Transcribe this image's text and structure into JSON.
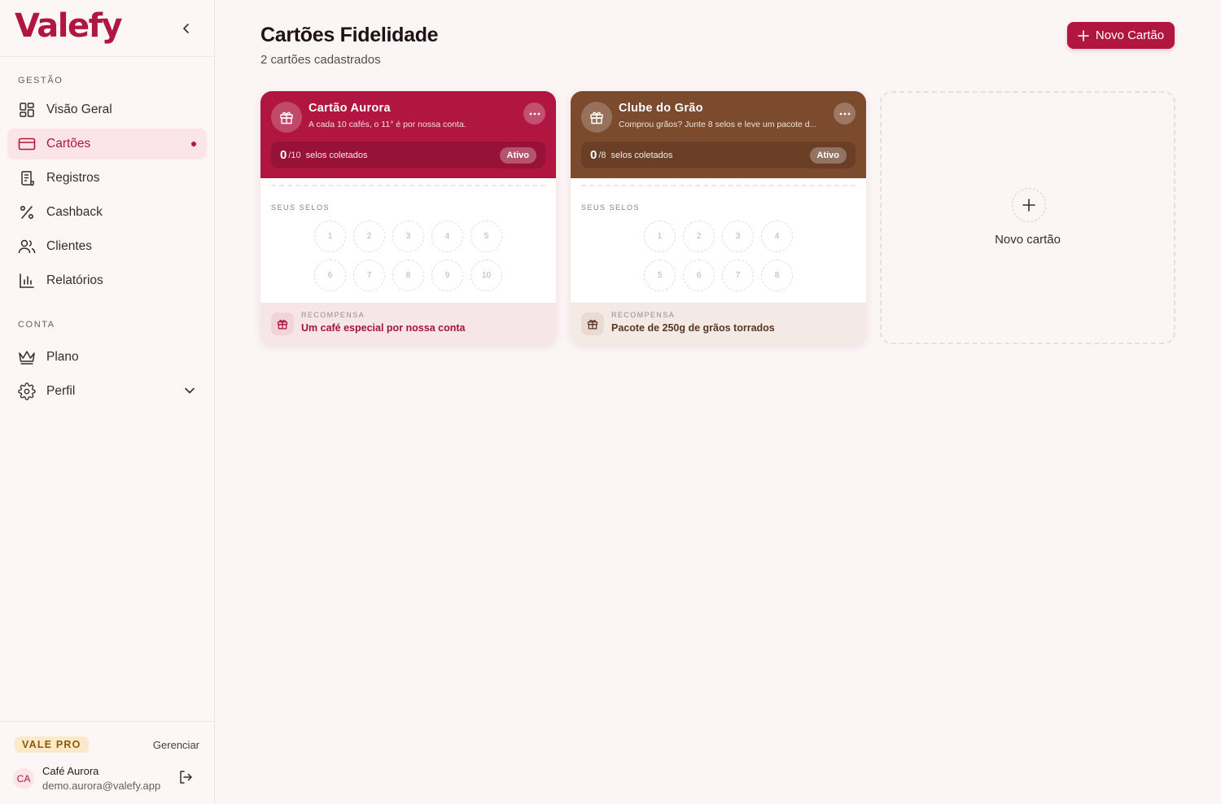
{
  "brand": {
    "name": "Valefy"
  },
  "sidebar": {
    "sections": [
      {
        "label": "GESTÃO"
      },
      {
        "label": "CONTA"
      }
    ],
    "items": [
      {
        "label": "Visão Geral",
        "icon": "grid-icon"
      },
      {
        "label": "Cartões",
        "icon": "credit-card-icon",
        "active": true
      },
      {
        "label": "Registros",
        "icon": "receipt-icon"
      },
      {
        "label": "Cashback",
        "icon": "percent-icon"
      },
      {
        "label": "Clientes",
        "icon": "users-icon"
      },
      {
        "label": "Relatórios",
        "icon": "bar-chart-icon"
      },
      {
        "label": "Plano",
        "icon": "crown-icon"
      },
      {
        "label": "Perfil",
        "icon": "gear-icon"
      }
    ],
    "plan": {
      "badge": "VALE PRO",
      "manage": "Gerenciar"
    },
    "user": {
      "initials": "CA",
      "name": "Café Aurora",
      "email": "demo.aurora@valefy.app"
    }
  },
  "header": {
    "title": "Cartões Fidelidade",
    "subtitle": "2 cartões cadastrados",
    "new_button": "Novo Cartão"
  },
  "cards": [
    {
      "title": "Cartão Aurora",
      "description": "A cada 10 cafés, o 11° é por nossa conta.",
      "collected": "0",
      "total": "/10",
      "collected_label": "selos coletados",
      "status": "Ativo",
      "stamps_label": "SEUS SELOS",
      "stamps": [
        "1",
        "2",
        "3",
        "4",
        "5",
        "6",
        "7",
        "8",
        "9",
        "10"
      ],
      "reward_label": "RECOMPENSA",
      "reward": "Um café especial por nossa conta",
      "color": "#b0163f",
      "foot_bg": "#f6e6e8",
      "reward_color": "#a3143a"
    },
    {
      "title": "Clube do Grão",
      "description": "Comprou grãos? Junte 8 selos e leve um pacote d...",
      "collected": "0",
      "total": "/8",
      "collected_label": "selos coletados",
      "status": "Ativo",
      "stamps_label": "SEUS SELOS",
      "stamps": [
        "1",
        "2",
        "3",
        "4",
        "5",
        "6",
        "7",
        "8"
      ],
      "reward_label": "RECOMPENSA",
      "reward": "Pacote de 250g de grãos torrados",
      "color": "#7c4a2d",
      "foot_bg": "#f3eae6",
      "reward_color": "#5a3520"
    }
  ],
  "add_card": {
    "label": "Novo cartão"
  }
}
